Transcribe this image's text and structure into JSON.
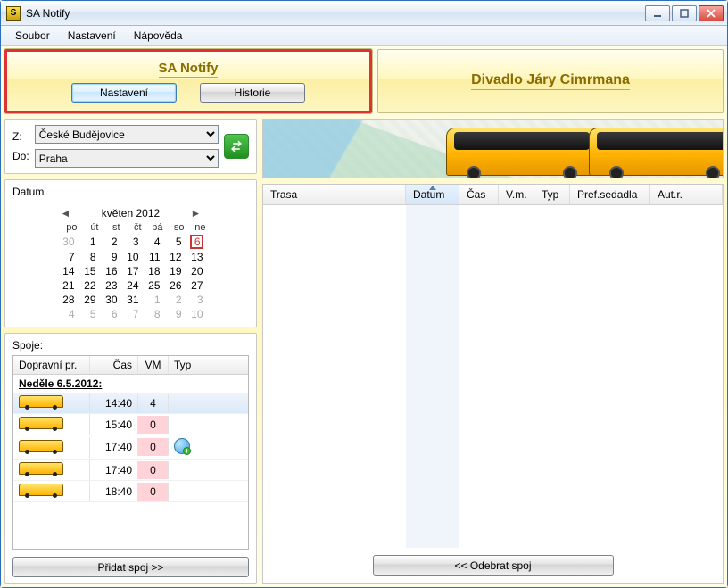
{
  "window": {
    "title": "SA Notify",
    "icon_glyph": "S"
  },
  "menubar": [
    "Soubor",
    "Nastavení",
    "Nápověda"
  ],
  "top_left": {
    "title": "SA Notify",
    "btn_settings": "Nastavení",
    "btn_history": "Historie"
  },
  "top_right": {
    "link": "Divadlo Járy Cimrmana"
  },
  "route": {
    "from_label": "Z:",
    "to_label": "Do:",
    "from_value": "České Budějovice",
    "to_value": "Praha"
  },
  "datum": {
    "label": "Datum",
    "month_title": "květen 2012",
    "dow": [
      "po",
      "út",
      "st",
      "čt",
      "pá",
      "so",
      "ne"
    ],
    "weeks": [
      [
        {
          "d": 30,
          "other": true
        },
        {
          "d": 1
        },
        {
          "d": 2
        },
        {
          "d": 3
        },
        {
          "d": 4
        },
        {
          "d": 5
        },
        {
          "d": 6,
          "today": true
        }
      ],
      [
        {
          "d": 7
        },
        {
          "d": 8
        },
        {
          "d": 9
        },
        {
          "d": 10
        },
        {
          "d": 11
        },
        {
          "d": 12
        },
        {
          "d": 13
        }
      ],
      [
        {
          "d": 14
        },
        {
          "d": 15
        },
        {
          "d": 16
        },
        {
          "d": 17
        },
        {
          "d": 18
        },
        {
          "d": 19
        },
        {
          "d": 20
        }
      ],
      [
        {
          "d": 21
        },
        {
          "d": 22
        },
        {
          "d": 23
        },
        {
          "d": 24
        },
        {
          "d": 25
        },
        {
          "d": 26
        },
        {
          "d": 27
        }
      ],
      [
        {
          "d": 28
        },
        {
          "d": 29
        },
        {
          "d": 30
        },
        {
          "d": 31
        },
        {
          "d": 1,
          "other": true
        },
        {
          "d": 2,
          "other": true
        },
        {
          "d": 3,
          "other": true
        }
      ],
      [
        {
          "d": 4,
          "other": true
        },
        {
          "d": 5,
          "other": true
        },
        {
          "d": 6,
          "other": true
        },
        {
          "d": 7,
          "other": true
        },
        {
          "d": 8,
          "other": true
        },
        {
          "d": 9,
          "other": true
        },
        {
          "d": 10,
          "other": true
        }
      ]
    ]
  },
  "spoje": {
    "label": "Spoje:",
    "columns": [
      "Dopravní pr.",
      "Čas",
      "VM",
      "Typ"
    ],
    "group": "Neděle 6.5.2012:",
    "rows": [
      {
        "time": "14:40",
        "vm": "4",
        "selected": true,
        "extra": false
      },
      {
        "time": "15:40",
        "vm": "0",
        "extra": false
      },
      {
        "time": "17:40",
        "vm": "0",
        "extra": true
      },
      {
        "time": "17:40",
        "vm": "0",
        "extra": false
      },
      {
        "time": "18:40",
        "vm": "0",
        "extra": false
      }
    ],
    "add_btn": "Přidat spoj >>"
  },
  "grid": {
    "columns": [
      "Trasa",
      "Datum",
      "Čas",
      "V.m.",
      "Typ",
      "Pref.sedadla",
      "Aut.r."
    ],
    "sorted_column_index": 1,
    "remove_btn": "<< Odebrat spoj"
  }
}
